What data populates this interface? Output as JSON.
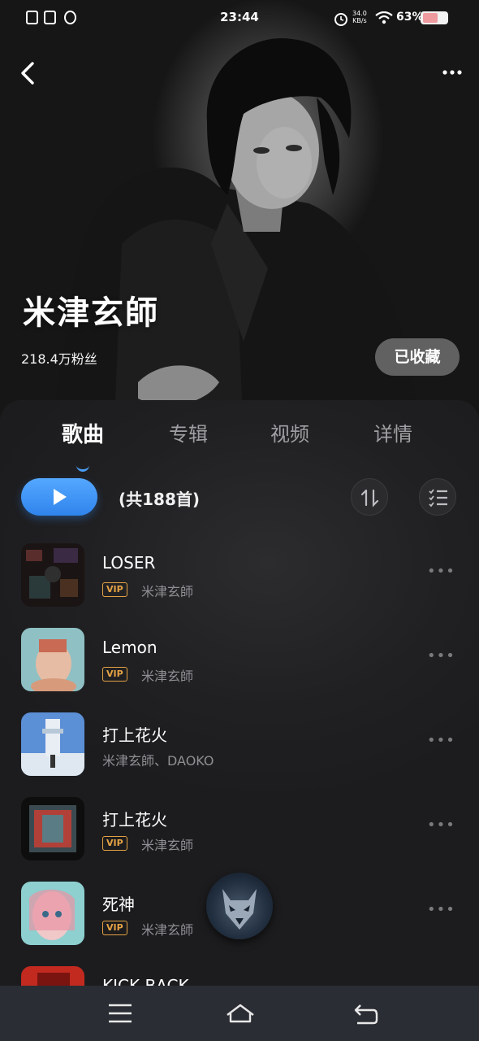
{
  "status_bar": {
    "time": "23:44",
    "net_speed_value": "34.0",
    "net_speed_unit": "KB/s",
    "battery_percent": "63%",
    "battery_level": 0.63
  },
  "artist": {
    "name": "米津玄師",
    "followers": "218.4万粉丝",
    "follow_label": "已收藏"
  },
  "tabs": [
    {
      "label": "歌曲",
      "active": true
    },
    {
      "label": "专辑",
      "active": false
    },
    {
      "label": "视频",
      "active": false
    },
    {
      "label": "详情",
      "active": false
    }
  ],
  "song_count": "(共188首)",
  "songs": [
    {
      "title": "LOSER",
      "vip": true,
      "artist": "米津玄師",
      "vip_label": "VIP"
    },
    {
      "title": "Lemon",
      "vip": true,
      "artist": "米津玄師",
      "vip_label": "VIP"
    },
    {
      "title": "打上花火",
      "vip": false,
      "artist": "米津玄師、DAOKO",
      "vip_label": ""
    },
    {
      "title": "打上花火",
      "vip": true,
      "artist": "米津玄師",
      "vip_label": "VIP"
    },
    {
      "title": "死神",
      "vip": true,
      "artist": "米津玄師",
      "vip_label": "VIP"
    },
    {
      "title": "KICK BACK",
      "vip": false,
      "artist": "",
      "vip_label": ""
    }
  ],
  "colors": {
    "accent": "#3d94f6",
    "vip": "#e5a244",
    "background": "#1d1d1f"
  }
}
